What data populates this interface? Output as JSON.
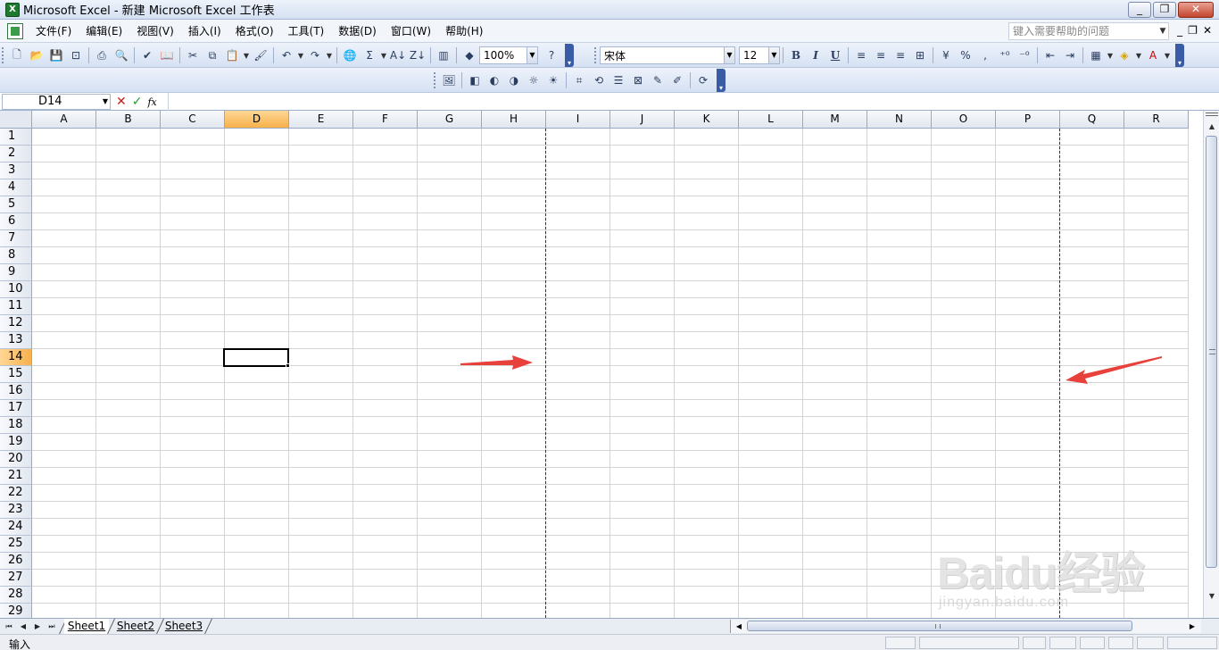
{
  "window": {
    "title": "Microsoft Excel - 新建 Microsoft Excel 工作表",
    "app_icon_letter": "X",
    "minimize": "_",
    "restore": "❐",
    "close": "✕"
  },
  "menu": {
    "items": [
      "文件(F)",
      "编辑(E)",
      "视图(V)",
      "插入(I)",
      "格式(O)",
      "工具(T)",
      "数据(D)",
      "窗口(W)",
      "帮助(H)"
    ],
    "help_placeholder": "键入需要帮助的问题",
    "doc_minimize": "_",
    "doc_restore": "❐",
    "doc_close": "✕"
  },
  "standard_toolbar": {
    "zoom": "100%"
  },
  "format_toolbar": {
    "font_name": "宋体",
    "font_size": "12",
    "bold": "B",
    "italic": "I",
    "underline": "U"
  },
  "formula_bar": {
    "name_box": "D14",
    "cancel": "✕",
    "enter": "✓",
    "fx": "fx",
    "content": ""
  },
  "grid": {
    "columns": [
      "A",
      "B",
      "C",
      "D",
      "E",
      "F",
      "G",
      "H",
      "I",
      "J",
      "K",
      "L",
      "M",
      "N",
      "O",
      "P",
      "Q",
      "R"
    ],
    "rows": [
      "1",
      "2",
      "3",
      "4",
      "5",
      "6",
      "7",
      "8",
      "9",
      "10",
      "11",
      "12",
      "13",
      "14",
      "15",
      "16",
      "17",
      "18",
      "19",
      "20",
      "21",
      "22",
      "23",
      "24",
      "25",
      "26",
      "27",
      "28",
      "29"
    ],
    "active_column": "D",
    "active_row": "14"
  },
  "sheets": {
    "tabs": [
      "Sheet1",
      "Sheet2",
      "Sheet3"
    ],
    "active": "Sheet1"
  },
  "status": {
    "mode": "输入"
  },
  "watermark": {
    "main": "Baidu经验",
    "sub": "jingyan.baidu.com"
  },
  "colors": {
    "active_header": "#f7b14b",
    "annotation_arrow": "#e8403a",
    "page_break": "#333333"
  }
}
